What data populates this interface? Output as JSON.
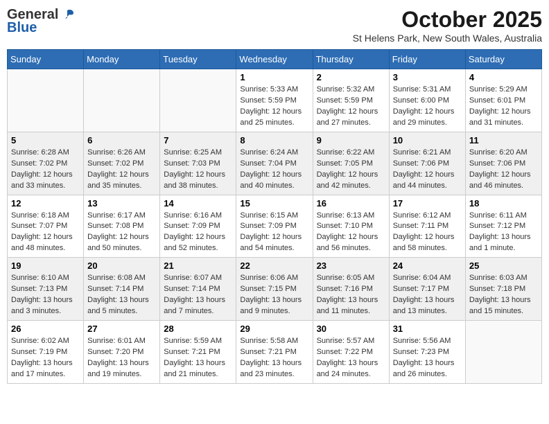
{
  "header": {
    "logo_general": "General",
    "logo_blue": "Blue",
    "month_title": "October 2025",
    "location": "St Helens Park, New South Wales, Australia"
  },
  "days_of_week": [
    "Sunday",
    "Monday",
    "Tuesday",
    "Wednesday",
    "Thursday",
    "Friday",
    "Saturday"
  ],
  "weeks": [
    [
      {
        "day": "",
        "info": ""
      },
      {
        "day": "",
        "info": ""
      },
      {
        "day": "",
        "info": ""
      },
      {
        "day": "1",
        "info": "Sunrise: 5:33 AM\nSunset: 5:59 PM\nDaylight: 12 hours\nand 25 minutes."
      },
      {
        "day": "2",
        "info": "Sunrise: 5:32 AM\nSunset: 5:59 PM\nDaylight: 12 hours\nand 27 minutes."
      },
      {
        "day": "3",
        "info": "Sunrise: 5:31 AM\nSunset: 6:00 PM\nDaylight: 12 hours\nand 29 minutes."
      },
      {
        "day": "4",
        "info": "Sunrise: 5:29 AM\nSunset: 6:01 PM\nDaylight: 12 hours\nand 31 minutes."
      }
    ],
    [
      {
        "day": "5",
        "info": "Sunrise: 6:28 AM\nSunset: 7:02 PM\nDaylight: 12 hours\nand 33 minutes."
      },
      {
        "day": "6",
        "info": "Sunrise: 6:26 AM\nSunset: 7:02 PM\nDaylight: 12 hours\nand 35 minutes."
      },
      {
        "day": "7",
        "info": "Sunrise: 6:25 AM\nSunset: 7:03 PM\nDaylight: 12 hours\nand 38 minutes."
      },
      {
        "day": "8",
        "info": "Sunrise: 6:24 AM\nSunset: 7:04 PM\nDaylight: 12 hours\nand 40 minutes."
      },
      {
        "day": "9",
        "info": "Sunrise: 6:22 AM\nSunset: 7:05 PM\nDaylight: 12 hours\nand 42 minutes."
      },
      {
        "day": "10",
        "info": "Sunrise: 6:21 AM\nSunset: 7:06 PM\nDaylight: 12 hours\nand 44 minutes."
      },
      {
        "day": "11",
        "info": "Sunrise: 6:20 AM\nSunset: 7:06 PM\nDaylight: 12 hours\nand 46 minutes."
      }
    ],
    [
      {
        "day": "12",
        "info": "Sunrise: 6:18 AM\nSunset: 7:07 PM\nDaylight: 12 hours\nand 48 minutes."
      },
      {
        "day": "13",
        "info": "Sunrise: 6:17 AM\nSunset: 7:08 PM\nDaylight: 12 hours\nand 50 minutes."
      },
      {
        "day": "14",
        "info": "Sunrise: 6:16 AM\nSunset: 7:09 PM\nDaylight: 12 hours\nand 52 minutes."
      },
      {
        "day": "15",
        "info": "Sunrise: 6:15 AM\nSunset: 7:09 PM\nDaylight: 12 hours\nand 54 minutes."
      },
      {
        "day": "16",
        "info": "Sunrise: 6:13 AM\nSunset: 7:10 PM\nDaylight: 12 hours\nand 56 minutes."
      },
      {
        "day": "17",
        "info": "Sunrise: 6:12 AM\nSunset: 7:11 PM\nDaylight: 12 hours\nand 58 minutes."
      },
      {
        "day": "18",
        "info": "Sunrise: 6:11 AM\nSunset: 7:12 PM\nDaylight: 13 hours\nand 1 minute."
      }
    ],
    [
      {
        "day": "19",
        "info": "Sunrise: 6:10 AM\nSunset: 7:13 PM\nDaylight: 13 hours\nand 3 minutes."
      },
      {
        "day": "20",
        "info": "Sunrise: 6:08 AM\nSunset: 7:14 PM\nDaylight: 13 hours\nand 5 minutes."
      },
      {
        "day": "21",
        "info": "Sunrise: 6:07 AM\nSunset: 7:14 PM\nDaylight: 13 hours\nand 7 minutes."
      },
      {
        "day": "22",
        "info": "Sunrise: 6:06 AM\nSunset: 7:15 PM\nDaylight: 13 hours\nand 9 minutes."
      },
      {
        "day": "23",
        "info": "Sunrise: 6:05 AM\nSunset: 7:16 PM\nDaylight: 13 hours\nand 11 minutes."
      },
      {
        "day": "24",
        "info": "Sunrise: 6:04 AM\nSunset: 7:17 PM\nDaylight: 13 hours\nand 13 minutes."
      },
      {
        "day": "25",
        "info": "Sunrise: 6:03 AM\nSunset: 7:18 PM\nDaylight: 13 hours\nand 15 minutes."
      }
    ],
    [
      {
        "day": "26",
        "info": "Sunrise: 6:02 AM\nSunset: 7:19 PM\nDaylight: 13 hours\nand 17 minutes."
      },
      {
        "day": "27",
        "info": "Sunrise: 6:01 AM\nSunset: 7:20 PM\nDaylight: 13 hours\nand 19 minutes."
      },
      {
        "day": "28",
        "info": "Sunrise: 5:59 AM\nSunset: 7:21 PM\nDaylight: 13 hours\nand 21 minutes."
      },
      {
        "day": "29",
        "info": "Sunrise: 5:58 AM\nSunset: 7:21 PM\nDaylight: 13 hours\nand 23 minutes."
      },
      {
        "day": "30",
        "info": "Sunrise: 5:57 AM\nSunset: 7:22 PM\nDaylight: 13 hours\nand 24 minutes."
      },
      {
        "day": "31",
        "info": "Sunrise: 5:56 AM\nSunset: 7:23 PM\nDaylight: 13 hours\nand 26 minutes."
      },
      {
        "day": "",
        "info": ""
      }
    ]
  ]
}
